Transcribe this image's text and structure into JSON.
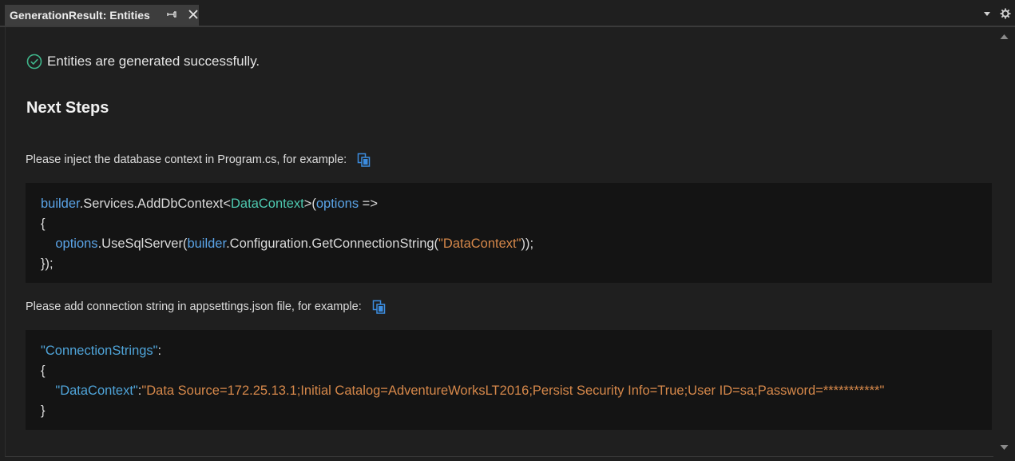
{
  "tab": {
    "title": "GenerationResult: Entities"
  },
  "success": {
    "message": "Entities are generated successfully."
  },
  "next_steps": {
    "heading": "Next Steps",
    "step1_text": "Please inject the database context in Program.cs, for example:",
    "step2_text": "Please add connection string in appsettings.json file, for example:"
  },
  "code1": {
    "l1_builder": "builder",
    "l1_services": ".Services.AddDbContext<",
    "l1_type": "DataContext",
    "l1_paren": ">(",
    "l1_options": "options",
    "l1_arrow": " =>",
    "l2": "{",
    "l3_indent": "    ",
    "l3_options": "options",
    "l3_use": ".UseSqlServer(",
    "l3_builder": "builder",
    "l3_config": ".Configuration.GetConnectionString(",
    "l3_str": "\"DataContext\"",
    "l3_end": "));",
    "l4": "});"
  },
  "code2": {
    "l1_key": "\"ConnectionStrings\"",
    "l1_colon": ":",
    "l2": "{",
    "l3_indent": "    ",
    "l3_key": "\"DataContext\"",
    "l3_colon": ":",
    "l3_value": "\"Data Source=172.25.13.1;Initial Catalog=AdventureWorksLT2016;Persist Security Info=True;User ID=sa;Password=***********\"",
    "l4": "}"
  },
  "icons": {
    "success": "check-circle-icon",
    "copy": "copy-icon",
    "pin": "pin-icon",
    "close": "close-icon",
    "dropdown": "dropdown-arrow-icon",
    "settings": "gear-icon"
  },
  "colors": {
    "background": "#1f1f1f",
    "code_background": "#141414",
    "success_green": "#3fb68b",
    "copy_blue": "#3c8de0",
    "code_identifier": "#5aa3e6",
    "code_type": "#4ec9b0",
    "code_string": "#d6884a"
  }
}
